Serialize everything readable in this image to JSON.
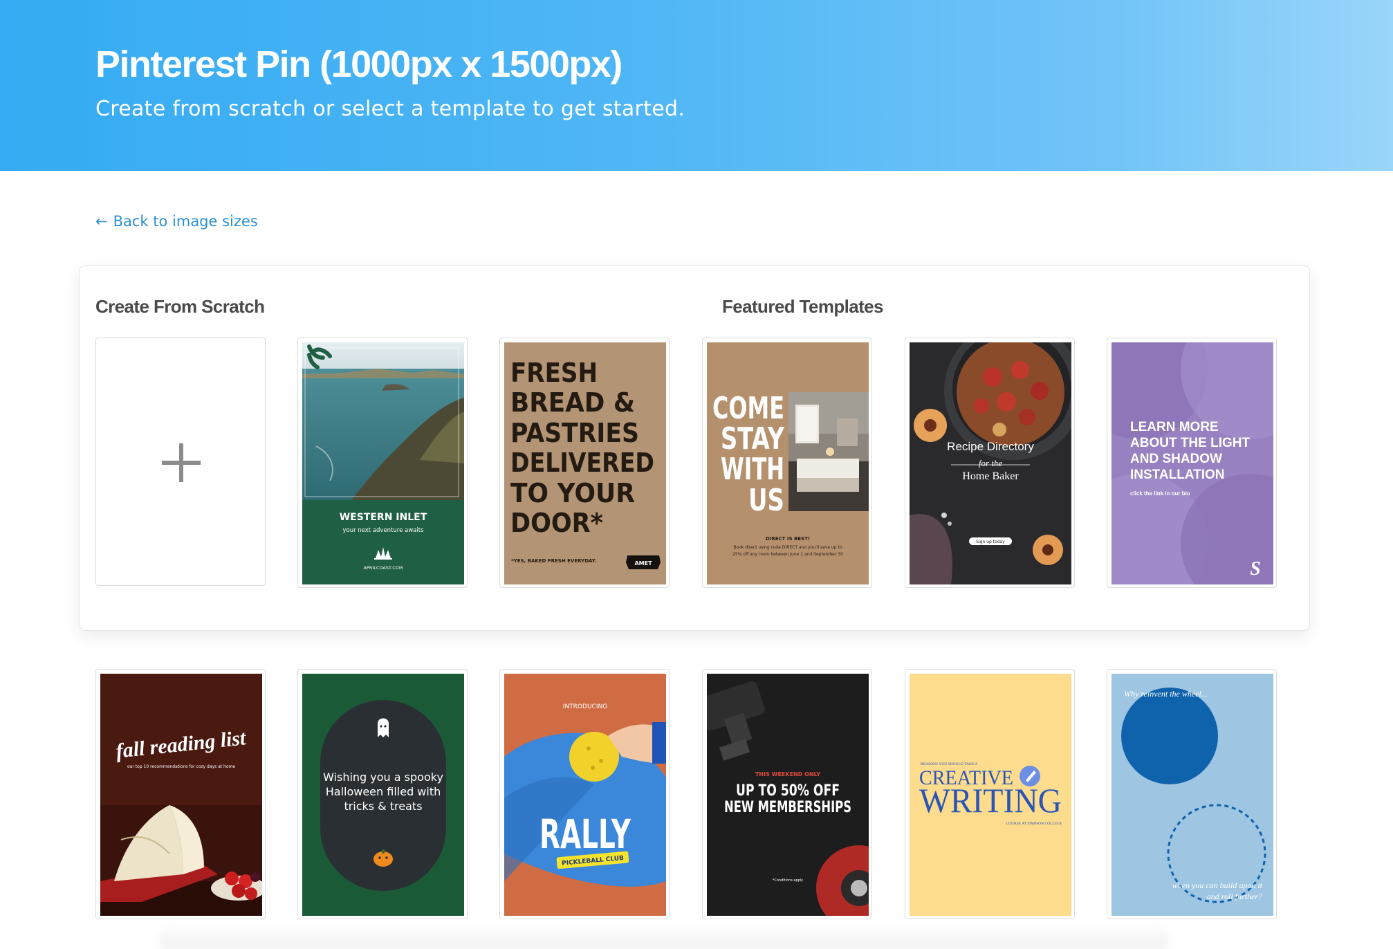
{
  "header": {
    "title": "Pinterest Pin (1000px x 1500px)",
    "subtitle": "Create from scratch or select a template to get started."
  },
  "back_link": {
    "arrow": "←",
    "label": "Back to image sizes"
  },
  "sections": {
    "scratch": "Create From Scratch",
    "featured": "Featured Templates"
  },
  "templates": {
    "t1": {
      "title": "WESTERN INLET",
      "tagline": "your next adventure awaits",
      "url": "APRILCOAST.COM"
    },
    "t2": {
      "lines": [
        "FRESH",
        "BREAD &",
        "PASTRIES",
        "DELIVERED",
        "TO YOUR",
        "DOOR*"
      ],
      "footnote": "*YES, BAKED FRESH EVERYDAY.",
      "badge": "AMET"
    },
    "t3": {
      "lines": [
        "COME",
        "STAY",
        "WITH",
        "US"
      ],
      "tag": "DIRECT IS BEST!",
      "body1": "Book direct using code DIRECT and you'll save up to",
      "body2": "25% off any room between June 1 and September 30"
    },
    "t4": {
      "title": "Recipe Directory",
      "sub1": "for the",
      "sub2": "Home Baker",
      "button": "Sign up today"
    },
    "t5": {
      "lines": [
        "LEARN MORE",
        "ABOUT THE LIGHT",
        "AND SHADOW",
        "INSTALLATION"
      ],
      "small": "click the link in our bio",
      "logo": "S"
    },
    "t6": {
      "title": "fall reading list",
      "sub": "our top 10 recommendations for cozy days at home"
    },
    "t7": {
      "lines": [
        "Wishing you a spooky",
        "Halloween filled with",
        "tricks & treats"
      ]
    },
    "t8": {
      "top": "INTRODUCING",
      "title": "RALLY",
      "badge": "PICKLEBALL CLUB"
    },
    "t9": {
      "tag": "THIS WEEKEND ONLY",
      "line1": "UP TO 50% OFF",
      "line2": "NEW MEMBERSHIPS",
      "note": "*Conditions apply"
    },
    "t10": {
      "top": "REASONS YOU SHOULD TAKE A",
      "line1": "CREATIVE",
      "line2": "WRITING",
      "bottom": "COURSE AT SIMPSON COLLEGE"
    },
    "t11": {
      "top": "Why reinvent the wheel...",
      "bottom1": "when you can build upon it",
      "bottom2": "and roll further?"
    }
  },
  "colors": {
    "header_start": "#35abf3",
    "header_end": "#9ad5fa",
    "link": "#2a8fd6",
    "heading": "#4a4a4a"
  }
}
